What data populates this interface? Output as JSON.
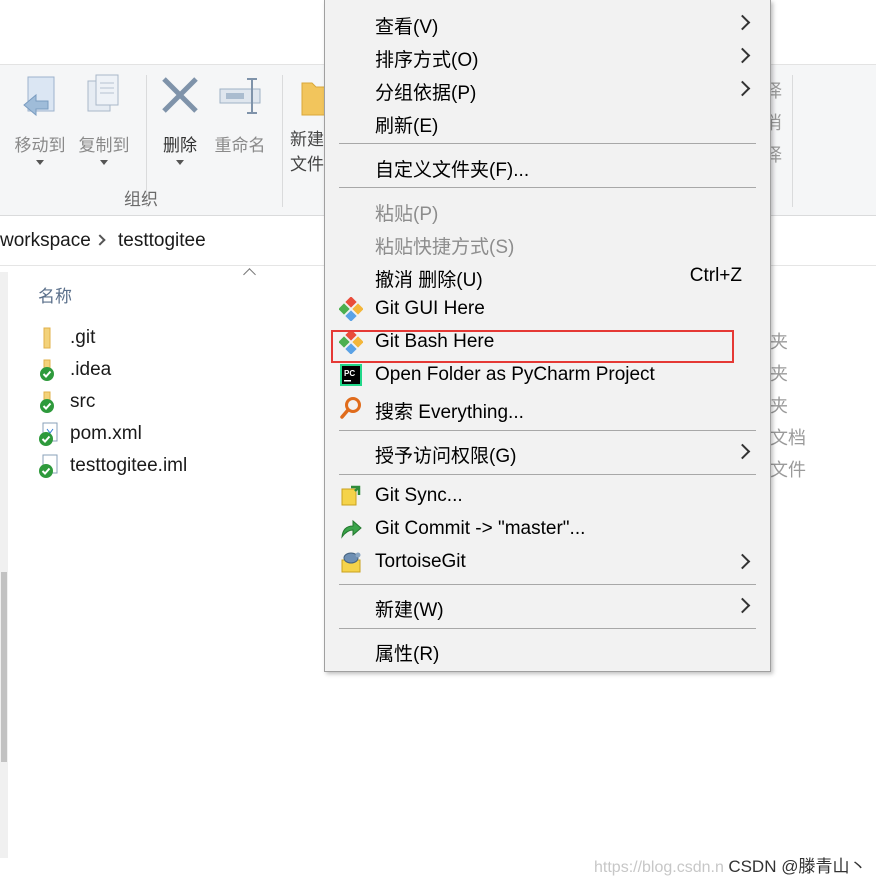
{
  "ribbon": {
    "buttons": [
      {
        "label": "移动到",
        "icon": "move-to-icon"
      },
      {
        "label": "复制到",
        "icon": "copy-to-icon"
      },
      {
        "label": "删除",
        "icon": "delete-x-icon"
      },
      {
        "label": "重命名",
        "icon": "rename-icon"
      },
      {
        "label": "新建",
        "line2": "文件",
        "icon": "new-folder-icon"
      }
    ],
    "group_label": "组织",
    "right_fragments": [
      "择",
      "消",
      "择"
    ]
  },
  "address": {
    "crumbs": [
      "workspace",
      "testtogitee"
    ]
  },
  "file_list": {
    "column_header": "名称",
    "files": [
      {
        "name": ".git",
        "icon": "folder-icon"
      },
      {
        "name": ".idea",
        "icon": "folder-check-icon"
      },
      {
        "name": "src",
        "icon": "folder-check-icon"
      },
      {
        "name": "pom.xml",
        "icon": "xml-file-check-icon"
      },
      {
        "name": "testtogitee.iml",
        "icon": "file-check-icon"
      }
    ],
    "type_fragments": [
      "夹",
      "夹",
      "夹",
      "文档",
      "文件"
    ]
  },
  "context_menu": {
    "items": [
      {
        "label": "查看(V)",
        "submenu": true
      },
      {
        "label": "排序方式(O)",
        "submenu": true
      },
      {
        "label": "分组依据(P)",
        "submenu": true
      },
      {
        "label": "刷新(E)"
      },
      {
        "label": "自定义文件夹(F)..."
      },
      {
        "label": "粘贴(P)",
        "disabled": true
      },
      {
        "label": "粘贴快捷方式(S)",
        "disabled": true
      },
      {
        "label": "撤消 删除(U)",
        "shortcut": "Ctrl+Z"
      },
      {
        "label": "Git GUI Here",
        "icon": "git-gui-icon"
      },
      {
        "label": "Git Bash Here",
        "icon": "git-bash-icon",
        "highlighted": true
      },
      {
        "label": "Open Folder as PyCharm Project",
        "icon": "pycharm-icon"
      },
      {
        "label": "搜索 Everything...",
        "icon": "everything-search-icon"
      },
      {
        "label": "授予访问权限(G)",
        "submenu": true
      },
      {
        "label": "Git Sync...",
        "icon": "git-sync-icon"
      },
      {
        "label": "Git Commit -> \"master\"...",
        "icon": "git-commit-icon"
      },
      {
        "label": "TortoiseGit",
        "icon": "tortoisegit-icon",
        "submenu": true
      },
      {
        "label": "新建(W)",
        "submenu": true
      },
      {
        "label": "属性(R)"
      }
    ],
    "highlight_color": "#e53935"
  },
  "watermark": {
    "url": "https://blog.csdn.n",
    "brand": "CSDN @滕青山丶"
  }
}
